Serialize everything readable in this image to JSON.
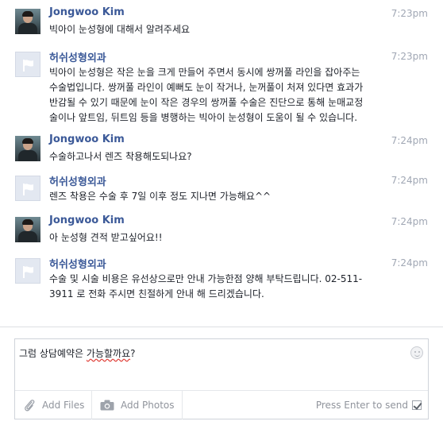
{
  "messages": [
    {
      "sender": "Jongwoo Kim",
      "avatar": "person-photo",
      "time": "7:23pm",
      "lines": [
        "빅아이 눈성형에 대해서 알려주세요"
      ]
    },
    {
      "sender": "허쉬성형외과",
      "avatar": "page-flag-icon",
      "time": "7:23pm",
      "lines": [
        "빅아이 눈성형은 작은 눈을 크게 만들어 주면서 동시에 쌍꺼풀 라인을 잡아주는",
        "수술법입니다. 쌍꺼풀 라인이 예뻐도 눈이 작거나, 눈꺼풀이 처져 있다면 효과가",
        "반감될 수 있기 때문에 눈이 작은 경우의 쌍꺼풀 수술은 진단으로 통해 눈매교정",
        "술이나 앞트임, 뒤트임 등을 병행하는 빅아이 눈성형이 도움이 될 수 있습니다."
      ]
    },
    {
      "sender": "Jongwoo Kim",
      "avatar": "person-photo",
      "time": "7:24pm",
      "lines": [
        "수술하고나서 렌즈 착용해도되나요?"
      ]
    },
    {
      "sender": "허쉬성형외과",
      "avatar": "page-flag-icon",
      "time": "7:24pm",
      "lines": [
        "렌즈 착용은 수술 후 7일 이후 정도 지나면 가능해요^^"
      ]
    },
    {
      "sender": "Jongwoo Kim",
      "avatar": "person-photo",
      "time": "7:24pm",
      "lines": [
        "아 눈성형 견적 받고싶어요!!"
      ]
    },
    {
      "sender": "허쉬성형외과",
      "avatar": "page-flag-icon",
      "time": "7:24pm",
      "lines": [
        "수술 및 시술 비용은 유선상으로만 안내 가능한점 양해 부탁드립니다. 02-511-",
        "3911 로 전화 주시면 친절하게 안내 해 드리겠습니다."
      ]
    }
  ],
  "composer": {
    "text_before": "그럼 상담예약은 ",
    "text_misspelled": "가능할까요",
    "text_after": "?",
    "emoji_icon": "smiley-icon",
    "add_files_label": "Add Files",
    "add_photos_label": "Add Photos",
    "send_hint": "Press Enter to send",
    "enter_to_send_checked": true
  },
  "colors": {
    "sender_name": "#3b5998",
    "timestamp": "#a0a7b4",
    "message_text": "#1d2129",
    "toolbar_text": "#90949c"
  }
}
